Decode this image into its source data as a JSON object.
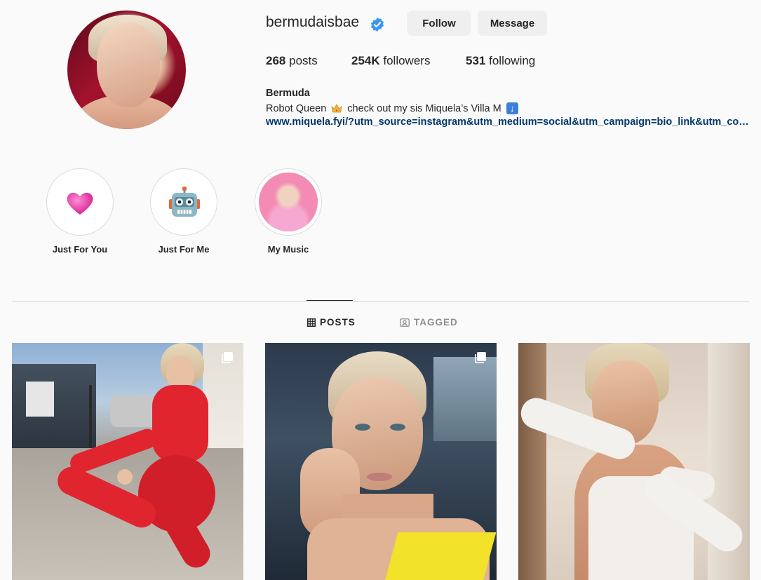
{
  "profile": {
    "username": "bermudaisbae",
    "verified": true,
    "follow_label": "Follow",
    "message_label": "Message",
    "posts_count": "268",
    "posts_label": "posts",
    "followers_count": "254K",
    "followers_label": "followers",
    "following_count": "531",
    "following_label": "following",
    "display_name": "Bermuda",
    "bio_part1": "Robot Queen",
    "bio_part2": "check out my sis Miquela’s Villa M",
    "bio_link": "www.miquela.fyi/?utm_source=instagram&utm_medium=social&utm_campaign=bio_link&utm_content=bermuda"
  },
  "highlights": [
    {
      "label": "Just For You",
      "icon": "heart-icon"
    },
    {
      "label": "Just For Me",
      "icon": "robot-icon"
    },
    {
      "label": "My Music",
      "icon": "photo-thumbnail"
    }
  ],
  "tabs": {
    "posts_label": "POSTS",
    "tagged_label": "TAGGED",
    "active": "POSTS"
  },
  "colors": {
    "link": "#00376b",
    "verified": "#3897f0",
    "button_bg": "#efefef",
    "post1_outfit": "#e0252f",
    "post2_top": "#f2e22a"
  }
}
